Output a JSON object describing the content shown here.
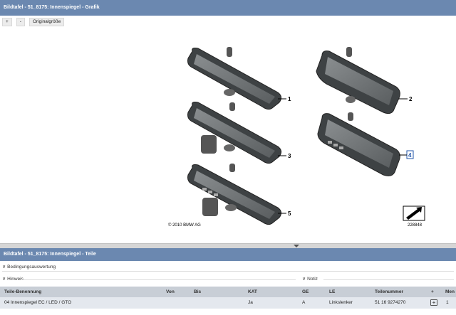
{
  "graphic_panel": {
    "title": "Bildtafel - 51_8175: Innenspiegel - Grafik",
    "toolbar": {
      "zoom_in": "+",
      "zoom_out": "-",
      "original_size": "Originalgröße"
    },
    "diagram": {
      "callouts": [
        "1",
        "2",
        "3",
        "4",
        "5"
      ],
      "copyright": "© 2010 BMW AG",
      "image_number": "228848"
    }
  },
  "parts_panel": {
    "title": "Bildtafel - 51_8175: Innenspiegel - Teile",
    "sections": {
      "condition": "Bedingungsauswertung",
      "note": "Hinweis",
      "notice": "Notiz"
    },
    "table": {
      "columns": [
        "Teile-Benennung",
        "Von",
        "Bis",
        "KAT",
        "GE",
        "LE",
        "Teilenummer",
        "+",
        "Men"
      ],
      "rows": [
        {
          "name": "04 Innenspiegel EC / LED / GTO",
          "von": "",
          "bis": "",
          "kat": "Ja",
          "ge": "A",
          "le": "Linkslenker",
          "number": "51 16 9274270",
          "cart_icon": "cart-add-icon",
          "qty": "1"
        }
      ]
    }
  }
}
